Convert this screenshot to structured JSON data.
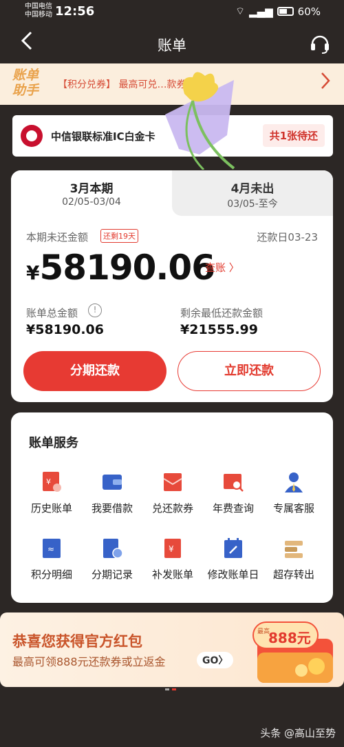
{
  "status": {
    "carrier_top": "中国电信",
    "carrier_bottom": "中国移动",
    "time": "12:56",
    "battery": "60%"
  },
  "nav": {
    "back_icon": "chevron-left-icon",
    "title": "账单",
    "service_icon": "headset-icon"
  },
  "promo_banner": {
    "logo_line1": "账单",
    "logo_line2": "助手",
    "text": "【积分兑券】 最高可兑…款券！"
  },
  "bank_card": {
    "name": "中信银联标准IC白金卡",
    "pending": "共1张待还"
  },
  "bill": {
    "tabs": [
      {
        "title": "3月本期",
        "range": "02/05-03/04"
      },
      {
        "title": "4月未出",
        "range": "03/05-至今"
      }
    ],
    "unpaid_label": "本期未还金额",
    "days_left_badge": "还剩19天",
    "due_date": "还款日03-23",
    "currency": "¥",
    "amount": "58190.06",
    "view_bill": "查账 〉",
    "total_label": "账单总金额",
    "total_value": "¥58190.06",
    "min_label": "剩余最低还款金额",
    "min_value": "¥21555.99",
    "btn_installment": "分期还款",
    "btn_repay": "立即还款"
  },
  "services": {
    "title": "账单服务",
    "items": [
      {
        "label": "历史账单",
        "icon": "history-bill-icon"
      },
      {
        "label": "我要借款",
        "icon": "wallet-icon"
      },
      {
        "label": "兑还款券",
        "icon": "coupon-icon"
      },
      {
        "label": "年费查询",
        "icon": "annual-fee-search-icon"
      },
      {
        "label": "专属客服",
        "icon": "customer-service-icon"
      },
      {
        "label": "积分明细",
        "icon": "points-detail-icon"
      },
      {
        "label": "分期记录",
        "icon": "installment-record-icon"
      },
      {
        "label": "补发账单",
        "icon": "reissue-bill-icon"
      },
      {
        "label": "修改账单日",
        "icon": "calendar-edit-icon"
      },
      {
        "label": "超存转出",
        "icon": "transfer-out-icon"
      }
    ]
  },
  "bottom_promo": {
    "title": "恭喜您获得官方红包",
    "subtitle": "最高可领888元还款券或立返金",
    "go": "GO〉",
    "art_label_top": "最高",
    "art_amount": "888元"
  },
  "watermark": "头条 @高山至势",
  "colors": {
    "primary_red": "#e73a33",
    "background_dark": "#2c2725",
    "promo_bg": "#fbeedd"
  }
}
